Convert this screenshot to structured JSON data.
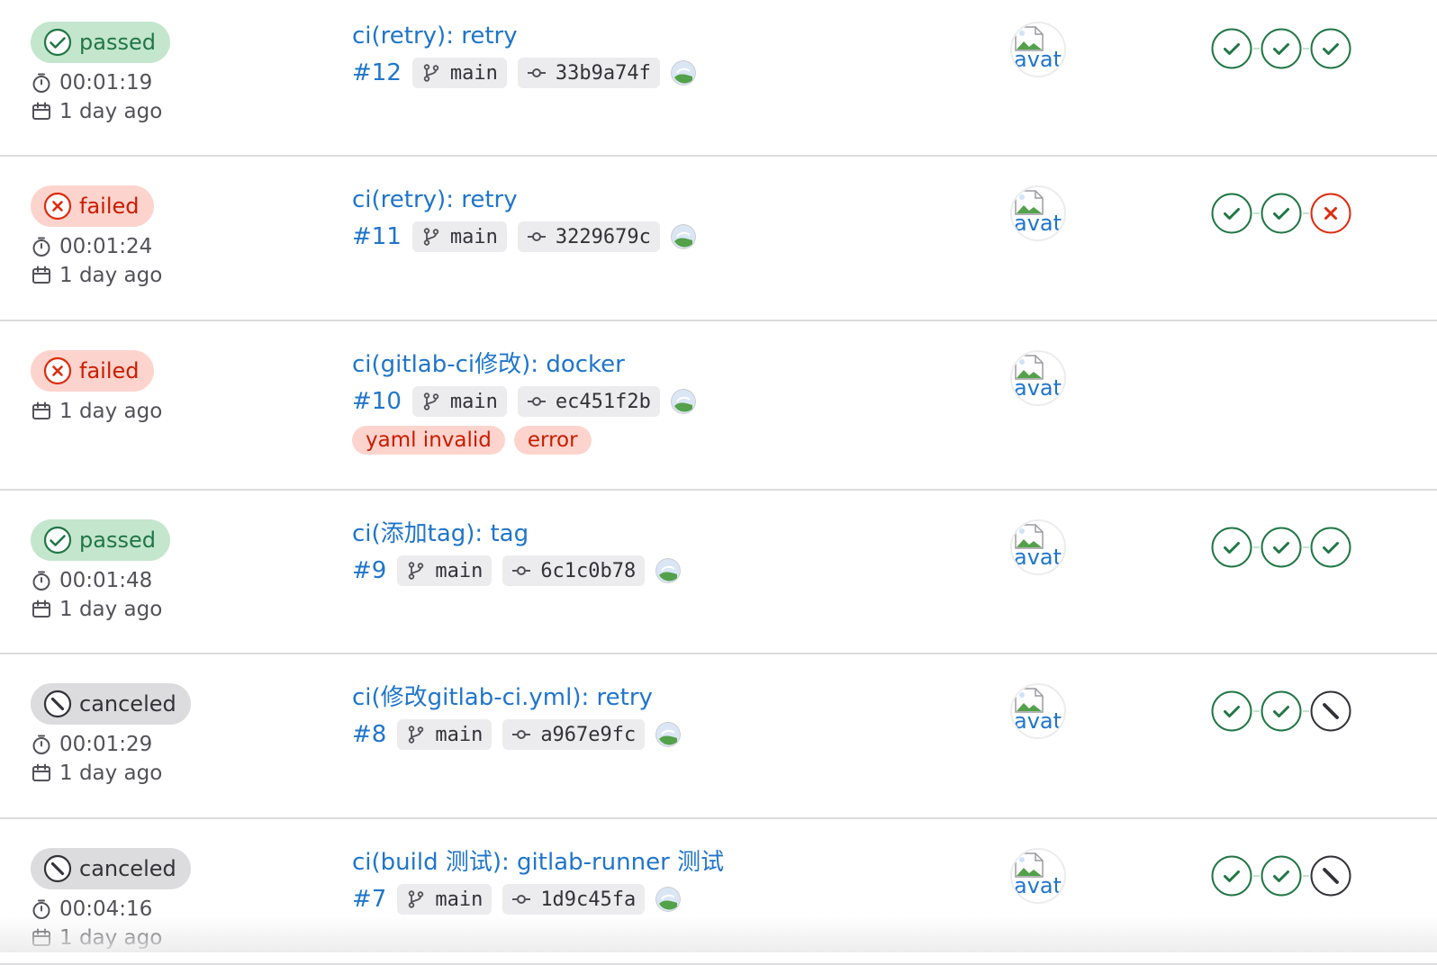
{
  "colors": {
    "success": "#217645",
    "failed": "#dd2b0e",
    "canceled": "#333238",
    "link": "#1f75cb"
  },
  "pipelines": [
    {
      "status": "success",
      "status_label": "passed",
      "duration": "00:01:19",
      "finished": "1 day ago",
      "commit_title": "ci(retry): retry",
      "id": "#12",
      "ref": "main",
      "sha": "33b9a74f",
      "avatar_alt": "avat",
      "stages": [
        "success",
        "success",
        "success"
      ],
      "labels": []
    },
    {
      "status": "failed",
      "status_label": "failed",
      "duration": "00:01:24",
      "finished": "1 day ago",
      "commit_title": "ci(retry): retry",
      "id": "#11",
      "ref": "main",
      "sha": "3229679c",
      "avatar_alt": "avat",
      "stages": [
        "success",
        "success",
        "failed"
      ],
      "labels": []
    },
    {
      "status": "failed",
      "status_label": "failed",
      "duration": null,
      "finished": "1 day ago",
      "commit_title": "ci(gitlab-ci修改): docker",
      "id": "#10",
      "ref": "main",
      "sha": "ec451f2b",
      "avatar_alt": "avat",
      "stages": [],
      "labels": [
        "yaml invalid",
        "error"
      ]
    },
    {
      "status": "success",
      "status_label": "passed",
      "duration": "00:01:48",
      "finished": "1 day ago",
      "commit_title": "ci(添加tag): tag",
      "id": "#9",
      "ref": "main",
      "sha": "6c1c0b78",
      "avatar_alt": "avat",
      "stages": [
        "success",
        "success",
        "success"
      ],
      "labels": []
    },
    {
      "status": "canceled",
      "status_label": "canceled",
      "duration": "00:01:29",
      "finished": "1 day ago",
      "commit_title": "ci(修改gitlab-ci.yml): retry",
      "id": "#8",
      "ref": "main",
      "sha": "a967e9fc",
      "avatar_alt": "avat",
      "stages": [
        "success",
        "success",
        "canceled"
      ],
      "labels": []
    },
    {
      "status": "canceled",
      "status_label": "canceled",
      "duration": "00:04:16",
      "finished": "1 day ago",
      "commit_title": "ci(build 测试): gitlab-runner 测试",
      "id": "#7",
      "ref": "main",
      "sha": "1d9c45fa",
      "avatar_alt": "avat",
      "stages": [
        "success",
        "success",
        "canceled"
      ],
      "labels": []
    }
  ]
}
